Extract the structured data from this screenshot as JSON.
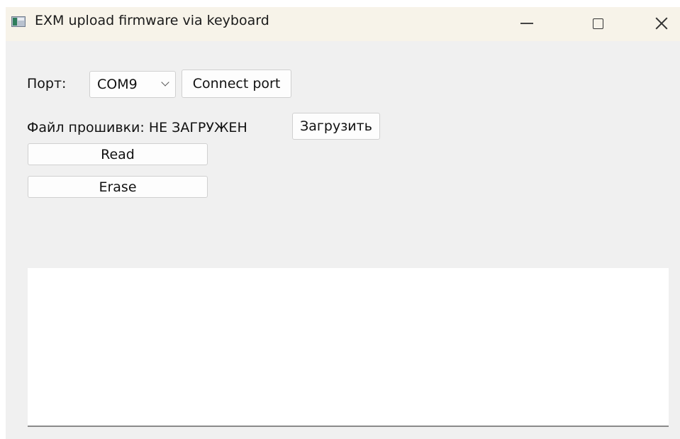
{
  "window": {
    "title": "EXM upload firmware via keyboard",
    "icon": "app-window-icon",
    "controls": {
      "minimize": "minimize-icon",
      "maximize": "maximize-icon",
      "close": "close-icon"
    }
  },
  "port": {
    "label": "Порт:",
    "selected": "COM9",
    "connect_button": "Connect port"
  },
  "firmware": {
    "label": "Файл прошивки: НЕ ЗАГРУЖЕН",
    "load_button": "Загрузить"
  },
  "actions": {
    "read_button": "Read",
    "erase_button": "Erase"
  },
  "log": {
    "text": ""
  }
}
